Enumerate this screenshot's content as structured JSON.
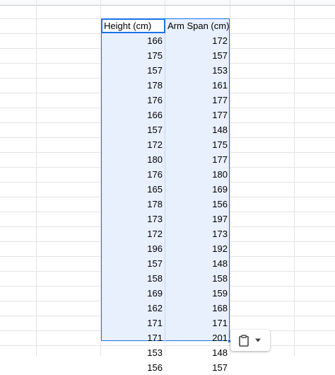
{
  "sheet": {
    "headers": [
      "Height (cm)",
      "Arm Span (cm)"
    ],
    "rows": [
      [
        "166",
        "172"
      ],
      [
        "175",
        "157"
      ],
      [
        "157",
        "153"
      ],
      [
        "178",
        "161"
      ],
      [
        "176",
        "177"
      ],
      [
        "166",
        "177"
      ],
      [
        "157",
        "148"
      ],
      [
        "172",
        "175"
      ],
      [
        "180",
        "177"
      ],
      [
        "176",
        "180"
      ],
      [
        "165",
        "169"
      ],
      [
        "178",
        "156"
      ],
      [
        "173",
        "197"
      ],
      [
        "172",
        "173"
      ],
      [
        "196",
        "192"
      ],
      [
        "157",
        "148"
      ],
      [
        "158",
        "158"
      ],
      [
        "169",
        "159"
      ],
      [
        "162",
        "168"
      ],
      [
        "171",
        "171"
      ],
      [
        "171",
        "201"
      ],
      [
        "153",
        "148"
      ],
      [
        "156",
        "157"
      ]
    ]
  },
  "paste_menu": {
    "icon": "clipboard-icon",
    "dropdown_icon": "caret-down-icon"
  },
  "colors": {
    "selection_fill": "#e8f0fe",
    "selection_border": "#1a73e8",
    "gridline": "#e2e3e3"
  }
}
